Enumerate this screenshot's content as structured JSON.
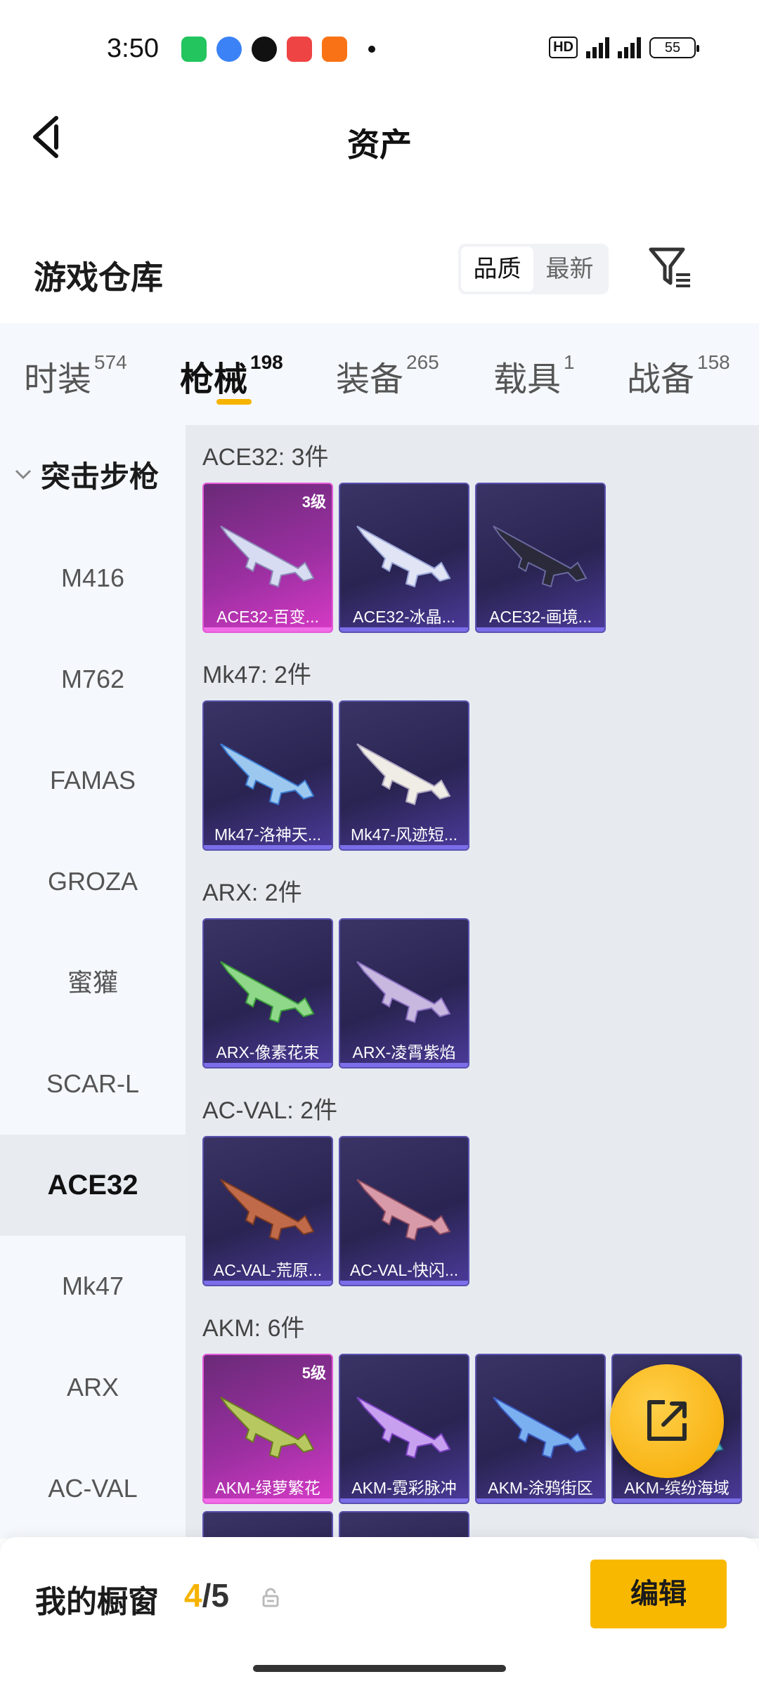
{
  "status": {
    "time": "3:50",
    "battery": "55",
    "hd": "HD",
    "net1": "4G",
    "net2": "4G"
  },
  "nav": {
    "title": "资产"
  },
  "warehouse": {
    "title": "游戏仓库",
    "sort_quality": "品质",
    "sort_latest": "最新"
  },
  "tabs": [
    {
      "label": "时装",
      "count": "574"
    },
    {
      "label": "枪械",
      "count": "198"
    },
    {
      "label": "装备",
      "count": "265"
    },
    {
      "label": "载具",
      "count": "1"
    },
    {
      "label": "战备",
      "count": "158"
    }
  ],
  "sidebar": {
    "header": "突击步枪",
    "items": [
      "M416",
      "M762",
      "FAMAS",
      "GROZA",
      "蜜獾",
      "SCAR-L",
      "ACE32",
      "Mk47",
      "ARX",
      "AC-VAL"
    ]
  },
  "groups": [
    {
      "title": "ACE32: 3件",
      "items": [
        {
          "name": "ACE32-百变...",
          "level": "3级"
        },
        {
          "name": "ACE32-冰晶..."
        },
        {
          "name": "ACE32-画境..."
        }
      ]
    },
    {
      "title": "Mk47: 2件",
      "items": [
        {
          "name": "Mk47-洛神天..."
        },
        {
          "name": "Mk47-风迹短..."
        }
      ]
    },
    {
      "title": "ARX: 2件",
      "items": [
        {
          "name": "ARX-像素花束"
        },
        {
          "name": "ARX-凌霄紫焰"
        }
      ]
    },
    {
      "title": "AC-VAL: 2件",
      "items": [
        {
          "name": "AC-VAL-荒原..."
        },
        {
          "name": "AC-VAL-快闪..."
        }
      ]
    },
    {
      "title": "AKM: 6件",
      "items": [
        {
          "name": "AKM-绿萝繁花",
          "level": "5级"
        },
        {
          "name": "AKM-霓彩脉冲"
        },
        {
          "name": "AKM-涂鸦街区"
        },
        {
          "name": "AKM-缤纷海域"
        }
      ]
    }
  ],
  "bottom": {
    "label": "我的橱窗",
    "current": "4",
    "sep": "/",
    "total": "5",
    "edit": "编辑"
  },
  "colors": {
    "accent": "#f8b800",
    "card_epic": "#d63ac6",
    "card_rare": "#5a52b0"
  }
}
